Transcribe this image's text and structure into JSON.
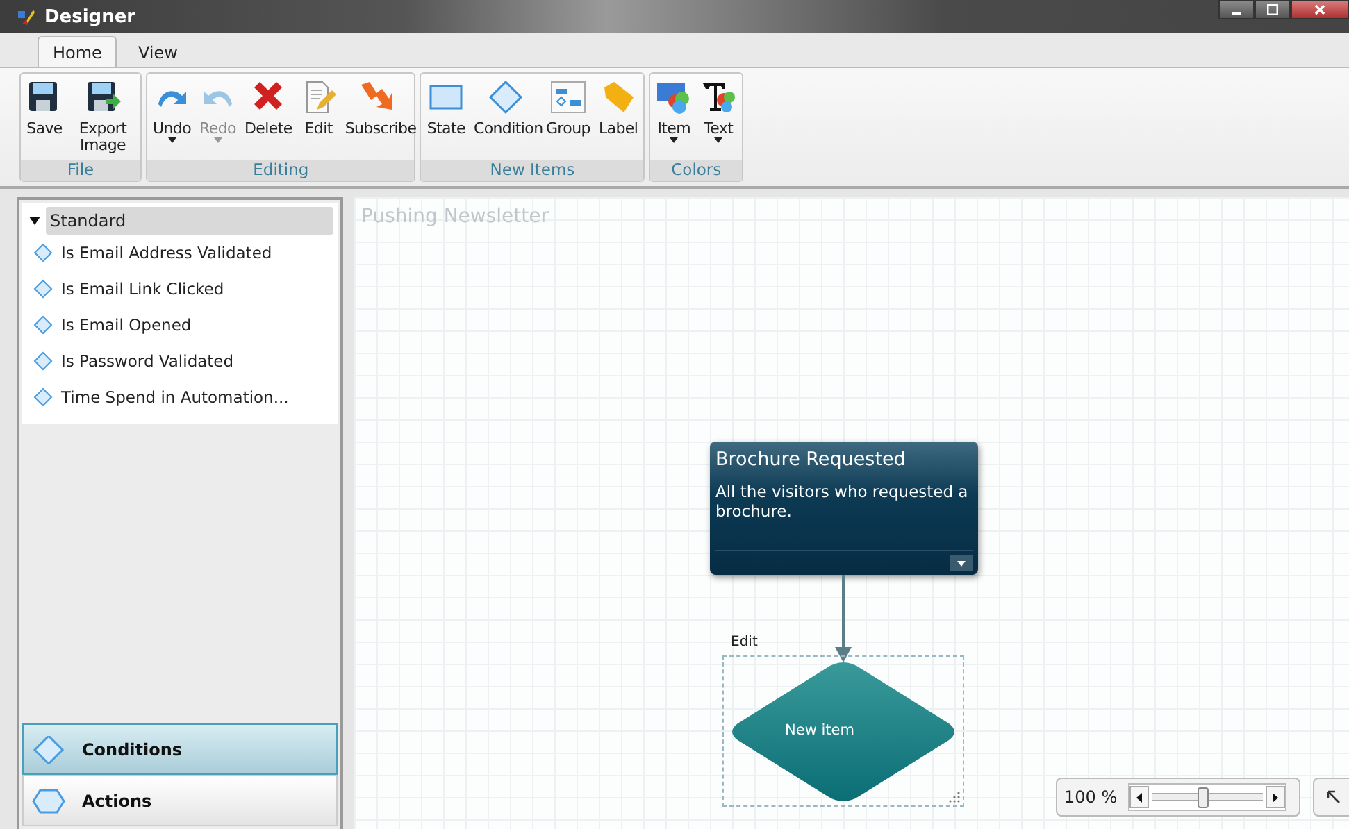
{
  "window": {
    "title": "Designer"
  },
  "tabs": [
    {
      "label": "Home",
      "selected": true
    },
    {
      "label": "View",
      "selected": false
    }
  ],
  "ribbon": [
    {
      "label": "File",
      "buttons": [
        {
          "label": "Save",
          "kind": "save",
          "disabled": false,
          "dropdown": false
        },
        {
          "label": "Export Image",
          "kind": "export",
          "disabled": false,
          "dropdown": false
        }
      ]
    },
    {
      "label": "Editing",
      "buttons": [
        {
          "label": "Undo",
          "kind": "undo",
          "disabled": false,
          "dropdown": true
        },
        {
          "label": "Redo",
          "kind": "redo",
          "disabled": true,
          "dropdown": true
        },
        {
          "label": "Delete",
          "kind": "delete",
          "disabled": false,
          "dropdown": false
        },
        {
          "label": "Edit",
          "kind": "edit",
          "disabled": false,
          "dropdown": false
        },
        {
          "label": "Subscribe",
          "kind": "subscribe",
          "disabled": false,
          "dropdown": false
        }
      ]
    },
    {
      "label": "New Items",
      "buttons": [
        {
          "label": "State",
          "kind": "state",
          "disabled": false,
          "dropdown": false
        },
        {
          "label": "Condition",
          "kind": "condition",
          "disabled": false,
          "dropdown": false
        },
        {
          "label": "Group",
          "kind": "group",
          "disabled": false,
          "dropdown": false
        },
        {
          "label": "Label",
          "kind": "label",
          "disabled": false,
          "dropdown": false
        }
      ]
    },
    {
      "label": "Colors",
      "buttons": [
        {
          "label": "Item",
          "kind": "item-color",
          "disabled": false,
          "dropdown": true
        },
        {
          "label": "Text",
          "kind": "text-color",
          "disabled": false,
          "dropdown": true
        }
      ]
    }
  ],
  "sidebar": {
    "category": {
      "label": "Standard",
      "expanded": true,
      "items": [
        {
          "label": "Is Email Address Validated"
        },
        {
          "label": "Is Email Link Clicked"
        },
        {
          "label": "Is Email Opened"
        },
        {
          "label": "Is Password Validated"
        },
        {
          "label": "Time Spend in Automation..."
        }
      ]
    },
    "sections": [
      {
        "label": "Conditions",
        "kind": "condition",
        "selected": true
      },
      {
        "label": "Actions",
        "kind": "action",
        "selected": false
      }
    ]
  },
  "canvas": {
    "title": "Pushing Newsletter",
    "card": {
      "title": "Brochure Requested",
      "description": "All the visitors who requested a brochure."
    },
    "selection_label": "Edit",
    "diamond": {
      "label": "New item"
    }
  },
  "zoom": {
    "reading": "100 %",
    "level": 0.45
  }
}
